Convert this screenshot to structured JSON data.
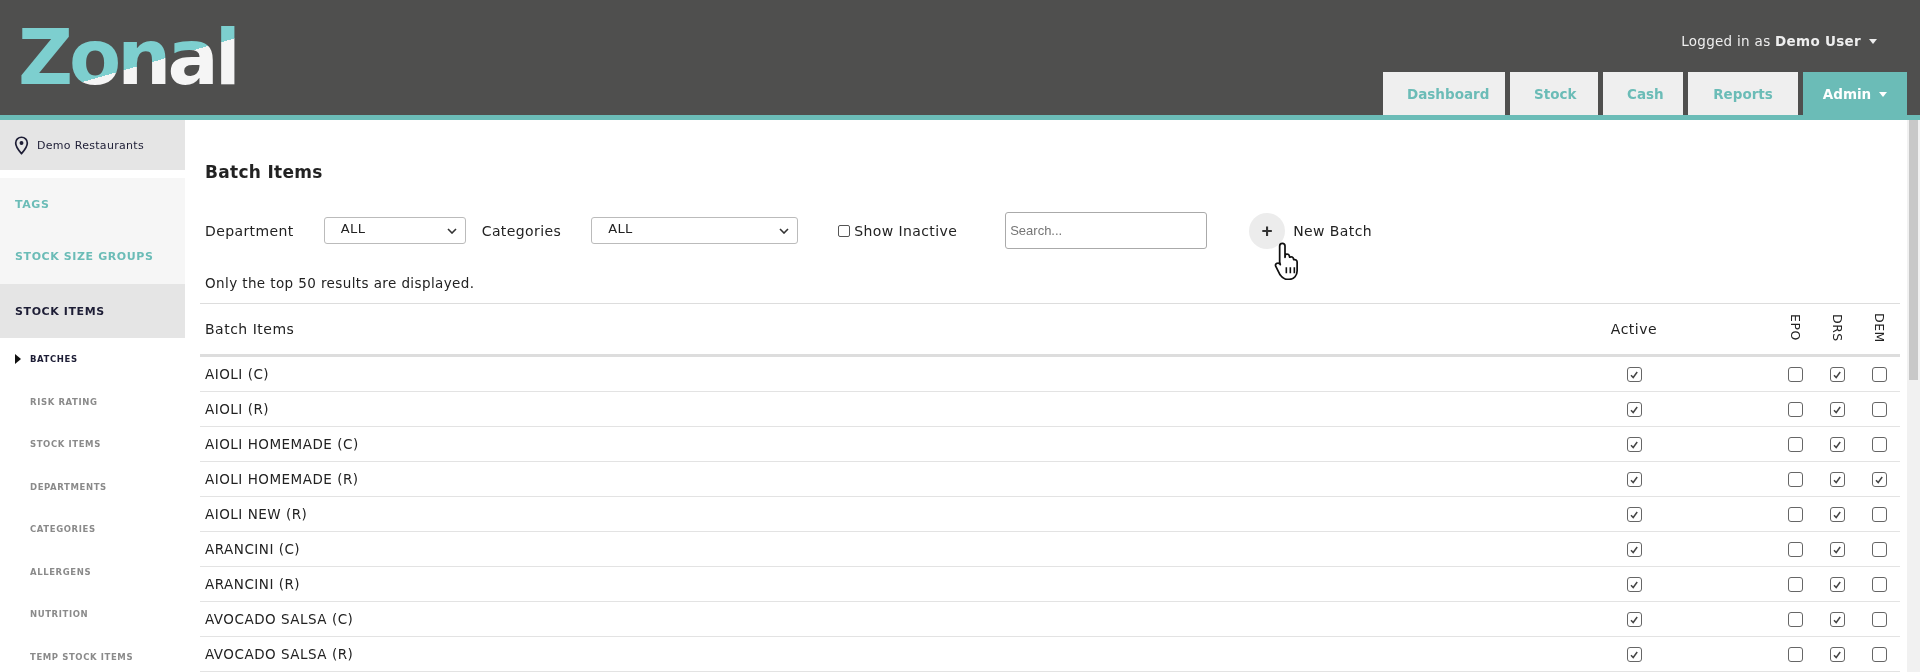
{
  "header": {
    "logo": "Zonal",
    "user": {
      "prefix": "Logged in as",
      "name": "Demo User"
    },
    "tabs": [
      {
        "label": "Dashboard",
        "selected": false,
        "dropdown": false
      },
      {
        "label": "Stock",
        "selected": false,
        "dropdown": false
      },
      {
        "label": "Cash",
        "selected": false,
        "dropdown": false
      },
      {
        "label": "Reports",
        "selected": false,
        "dropdown": false
      },
      {
        "label": "Admin",
        "selected": true,
        "dropdown": true
      }
    ]
  },
  "sidebar": {
    "location": "Demo Restaurants",
    "sections": [
      {
        "label": "TAGS",
        "selected": false
      },
      {
        "label": "STOCK SIZE GROUPS",
        "selected": false
      },
      {
        "label": "STOCK ITEMS",
        "selected": true
      }
    ],
    "items": [
      {
        "label": "BATCHES",
        "selected": true
      },
      {
        "label": "RISK RATING",
        "selected": false
      },
      {
        "label": "STOCK ITEMS",
        "selected": false
      },
      {
        "label": "DEPARTMENTS",
        "selected": false
      },
      {
        "label": "CATEGORIES",
        "selected": false
      },
      {
        "label": "ALLERGENS",
        "selected": false
      },
      {
        "label": "NUTRITION",
        "selected": false
      },
      {
        "label": "TEMP STOCK ITEMS",
        "selected": false
      }
    ]
  },
  "page": {
    "title": "Batch Items",
    "filters": {
      "department": {
        "label": "Department",
        "value": "ALL"
      },
      "categories": {
        "label": "Categories",
        "value": "ALL"
      },
      "show_inactive": {
        "label": "Show Inactive",
        "checked": false
      },
      "search": {
        "placeholder": "Search..."
      },
      "new_button": {
        "icon": "+",
        "label": "New Batch"
      }
    },
    "note": "Only the top 50 results are displayed.",
    "table": {
      "columns": [
        "Batch Items",
        "Active",
        "EPO",
        "DRS",
        "DEM"
      ],
      "rows": [
        {
          "name": "AIOLI (C)",
          "active": true,
          "epo": false,
          "drs": true,
          "dem": false
        },
        {
          "name": "AIOLI (R)",
          "active": true,
          "epo": false,
          "drs": true,
          "dem": false
        },
        {
          "name": "AIOLI HOMEMADE (C)",
          "active": true,
          "epo": false,
          "drs": true,
          "dem": false
        },
        {
          "name": "AIOLI HOMEMADE (R)",
          "active": true,
          "epo": false,
          "drs": true,
          "dem": true
        },
        {
          "name": "AIOLI NEW (R)",
          "active": true,
          "epo": false,
          "drs": true,
          "dem": false
        },
        {
          "name": "ARANCINI (C)",
          "active": true,
          "epo": false,
          "drs": true,
          "dem": false
        },
        {
          "name": "ARANCINI (R)",
          "active": true,
          "epo": false,
          "drs": true,
          "dem": false
        },
        {
          "name": "AVOCADO SALSA (C)",
          "active": true,
          "epo": false,
          "drs": true,
          "dem": false
        },
        {
          "name": "AVOCADO SALSA (R)",
          "active": true,
          "epo": false,
          "drs": true,
          "dem": false
        }
      ]
    }
  }
}
